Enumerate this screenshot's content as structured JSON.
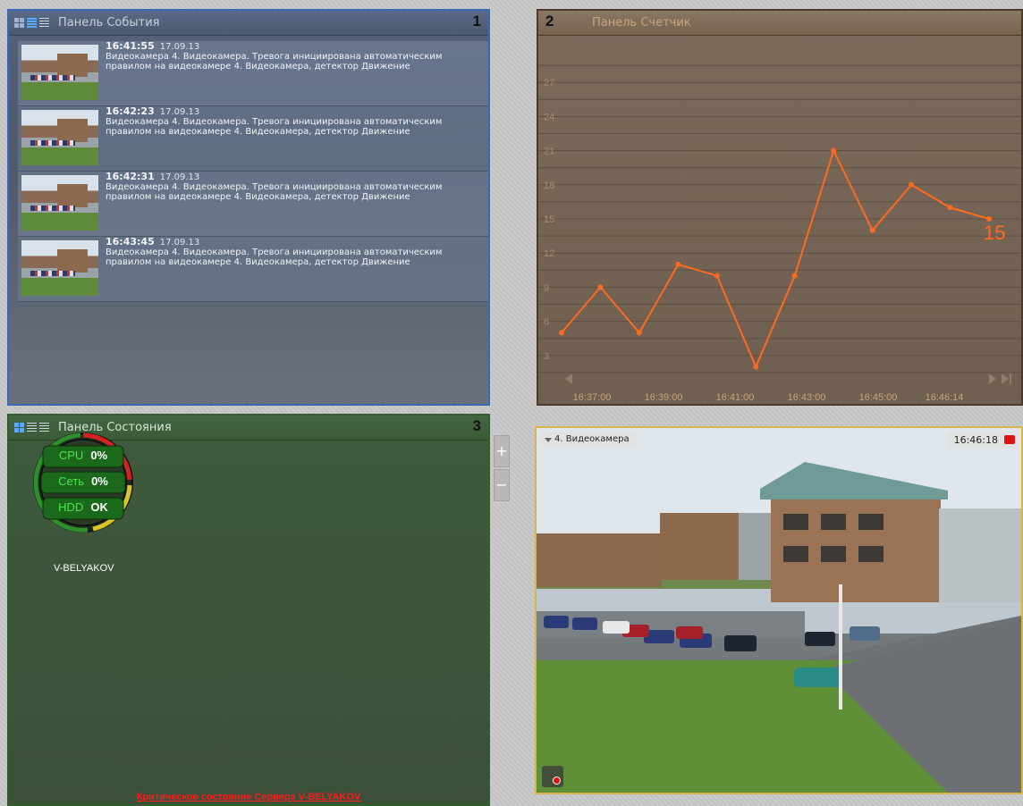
{
  "panels": {
    "events": {
      "title": "Панель События",
      "number": "1",
      "items": [
        {
          "time": "16:41:55",
          "date": "17.09.13",
          "text": "Видеокамера 4. Видеокамера. Тревога инициирована автоматическим правилом на видеокамере 4. Видеокамера, детектор Движение"
        },
        {
          "time": "16:42:23",
          "date": "17.09.13",
          "text": "Видеокамера 4. Видеокамера. Тревога инициирована автоматическим правилом на видеокамере 4. Видеокамера, детектор Движение"
        },
        {
          "time": "16:42:31",
          "date": "17.09.13",
          "text": "Видеокамера 4. Видеокамера. Тревога инициирована автоматическим правилом на видеокамере 4. Видеокамера, детектор Движение"
        },
        {
          "time": "16:43:45",
          "date": "17.09.13",
          "text": "Видеокамера 4. Видеокамера. Тревога инициирована автоматическим правилом на видеокамере 4. Видеокамера, детектор Движение"
        }
      ]
    },
    "counter": {
      "title": "Панель Счетчик",
      "number": "2"
    },
    "status": {
      "title": "Панель Состояния",
      "number": "3",
      "server": "V-BELYAKOV",
      "metrics": [
        {
          "label": "CPU",
          "value": "0%"
        },
        {
          "label": "Сеть",
          "value": "0%"
        },
        {
          "label": "HDD",
          "value": "OK"
        }
      ],
      "critical_message": "Критическое состояние Сервера V-BELYAKOV"
    },
    "camera": {
      "title": "4. Видеокамера",
      "time": "16:46:18"
    }
  },
  "zoom": {
    "plus": "+",
    "minus": "−"
  },
  "icons": [
    "grid-view-icon",
    "list-view-icon",
    "lines-view-icon",
    "scroll-left-icon",
    "scroll-right-icon",
    "scroll-end-icon",
    "rec-icon",
    "camera-menu-icon"
  ],
  "colors": {
    "events_border": "#3d67b8",
    "counter_line": "#ff6a1f",
    "status_ok": "#4ce04c",
    "critical": "#ff1a1a",
    "camera_border": "#d7b44c"
  },
  "chart_data": {
    "type": "line",
    "yticks": [
      3,
      6,
      9,
      12,
      15,
      18,
      21,
      24,
      27
    ],
    "ylim": [
      0,
      30
    ],
    "xticks": [
      "16:37:00",
      "16:39:00",
      "16:41:00",
      "16:43:00",
      "16:45:00",
      "16:46:14"
    ],
    "current_value": "15",
    "series": [
      {
        "values": [
          5,
          9,
          5,
          11,
          10,
          2,
          10,
          21,
          14,
          18,
          16,
          15
        ]
      }
    ]
  }
}
